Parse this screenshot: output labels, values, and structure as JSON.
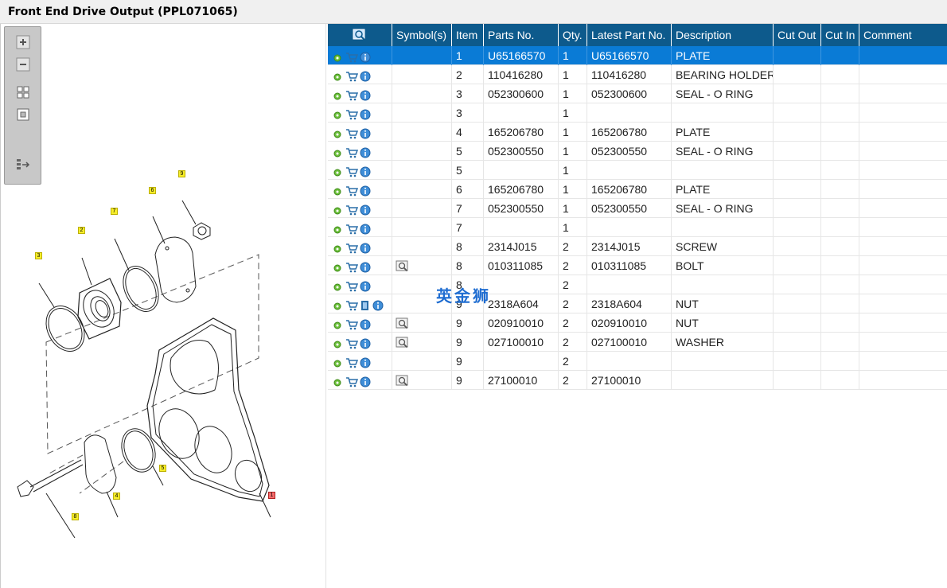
{
  "window": {
    "title": "Front End Drive Output (PPL071065)"
  },
  "watermark": "英金狮",
  "zoom_toolbar": {
    "buttons": [
      "zoom-in",
      "zoom-out",
      "fit-page",
      "fit-window",
      "toggle-panel"
    ]
  },
  "diagram": {
    "callouts": [
      "9",
      "6",
      "7",
      "2",
      "3",
      "1",
      "5",
      "4",
      "8"
    ]
  },
  "table": {
    "columns": {
      "tool": "search-icon",
      "symbol": "Symbol(s)",
      "item": "Item",
      "parts_no": "Parts No.",
      "qty": "Qty.",
      "latest": "Latest Part No.",
      "description": "Description",
      "cut_out": "Cut Out",
      "cut_in": "Cut In",
      "comment": "Comment"
    },
    "rows": [
      {
        "item": "1",
        "parts_no": "U65166570",
        "qty": "1",
        "latest": "U65166570",
        "description": "PLATE",
        "symbol": false,
        "selected": true
      },
      {
        "item": "2",
        "parts_no": "110416280",
        "qty": "1",
        "latest": "110416280",
        "description": "BEARING HOLDER",
        "symbol": false
      },
      {
        "item": "3",
        "parts_no": "052300600",
        "qty": "1",
        "latest": "052300600",
        "description": "SEAL - O RING",
        "symbol": false
      },
      {
        "item": "3",
        "parts_no": "",
        "qty": "1",
        "latest": "",
        "description": "",
        "symbol": false
      },
      {
        "item": "4",
        "parts_no": "165206780",
        "qty": "1",
        "latest": "165206780",
        "description": "PLATE",
        "symbol": false
      },
      {
        "item": "5",
        "parts_no": "052300550",
        "qty": "1",
        "latest": "052300550",
        "description": "SEAL - O RING",
        "symbol": false
      },
      {
        "item": "5",
        "parts_no": "",
        "qty": "1",
        "latest": "",
        "description": "",
        "symbol": false
      },
      {
        "item": "6",
        "parts_no": "165206780",
        "qty": "1",
        "latest": "165206780",
        "description": "PLATE",
        "symbol": false
      },
      {
        "item": "7",
        "parts_no": "052300550",
        "qty": "1",
        "latest": "052300550",
        "description": "SEAL - O RING",
        "symbol": false
      },
      {
        "item": "7",
        "parts_no": "",
        "qty": "1",
        "latest": "",
        "description": "",
        "symbol": false
      },
      {
        "item": "8",
        "parts_no": "2314J015",
        "qty": "2",
        "latest": "2314J015",
        "description": "SCREW",
        "symbol": false
      },
      {
        "item": "8",
        "parts_no": "010311085",
        "qty": "2",
        "latest": "010311085",
        "description": "BOLT",
        "symbol": true
      },
      {
        "item": "8",
        "parts_no": "",
        "qty": "2",
        "latest": "",
        "description": "",
        "symbol": false
      },
      {
        "item": "9",
        "parts_no": "2318A604",
        "qty": "2",
        "latest": "2318A604",
        "description": "NUT",
        "symbol": false,
        "book": true
      },
      {
        "item": "9",
        "parts_no": "020910010",
        "qty": "2",
        "latest": "020910010",
        "description": "NUT",
        "symbol": true
      },
      {
        "item": "9",
        "parts_no": "027100010",
        "qty": "2",
        "latest": "027100010",
        "description": "WASHER",
        "symbol": true
      },
      {
        "item": "9",
        "parts_no": "",
        "qty": "2",
        "latest": "",
        "description": "",
        "symbol": false
      },
      {
        "item": "9",
        "parts_no": "27100010",
        "qty": "2",
        "latest": "27100010",
        "description": "",
        "symbol": true
      }
    ]
  }
}
